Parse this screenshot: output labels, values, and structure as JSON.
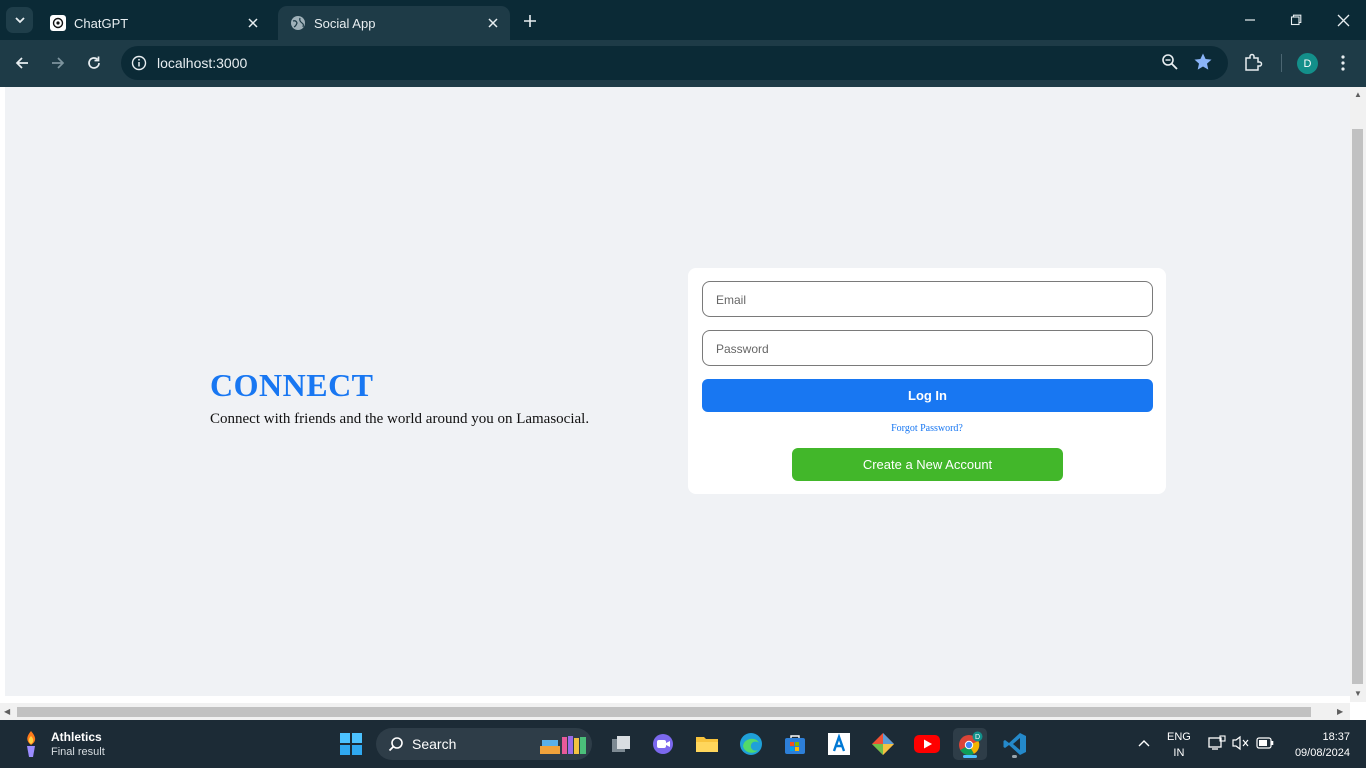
{
  "browser": {
    "tabs": [
      {
        "title": "ChatGPT",
        "active": false
      },
      {
        "title": "Social App",
        "active": true
      }
    ],
    "url": "localhost:3000",
    "profile_initial": "D"
  },
  "page": {
    "brand": "CONNECT",
    "tagline": "Connect with friends and the world around you on Lamasocial.",
    "email_placeholder": "Email",
    "password_placeholder": "Password",
    "login_label": "Log In",
    "forgot_label": "Forgot Password?",
    "create_label": "Create a New Account",
    "colors": {
      "brand": "#1877f2",
      "create": "#42b72a",
      "background": "#f0f2f5"
    }
  },
  "taskbar": {
    "weather_title": "Athletics",
    "weather_sub": "Final result",
    "search_label": "Search",
    "lang_1": "ENG",
    "lang_2": "IN",
    "time": "18:37",
    "date": "09/08/2024"
  }
}
